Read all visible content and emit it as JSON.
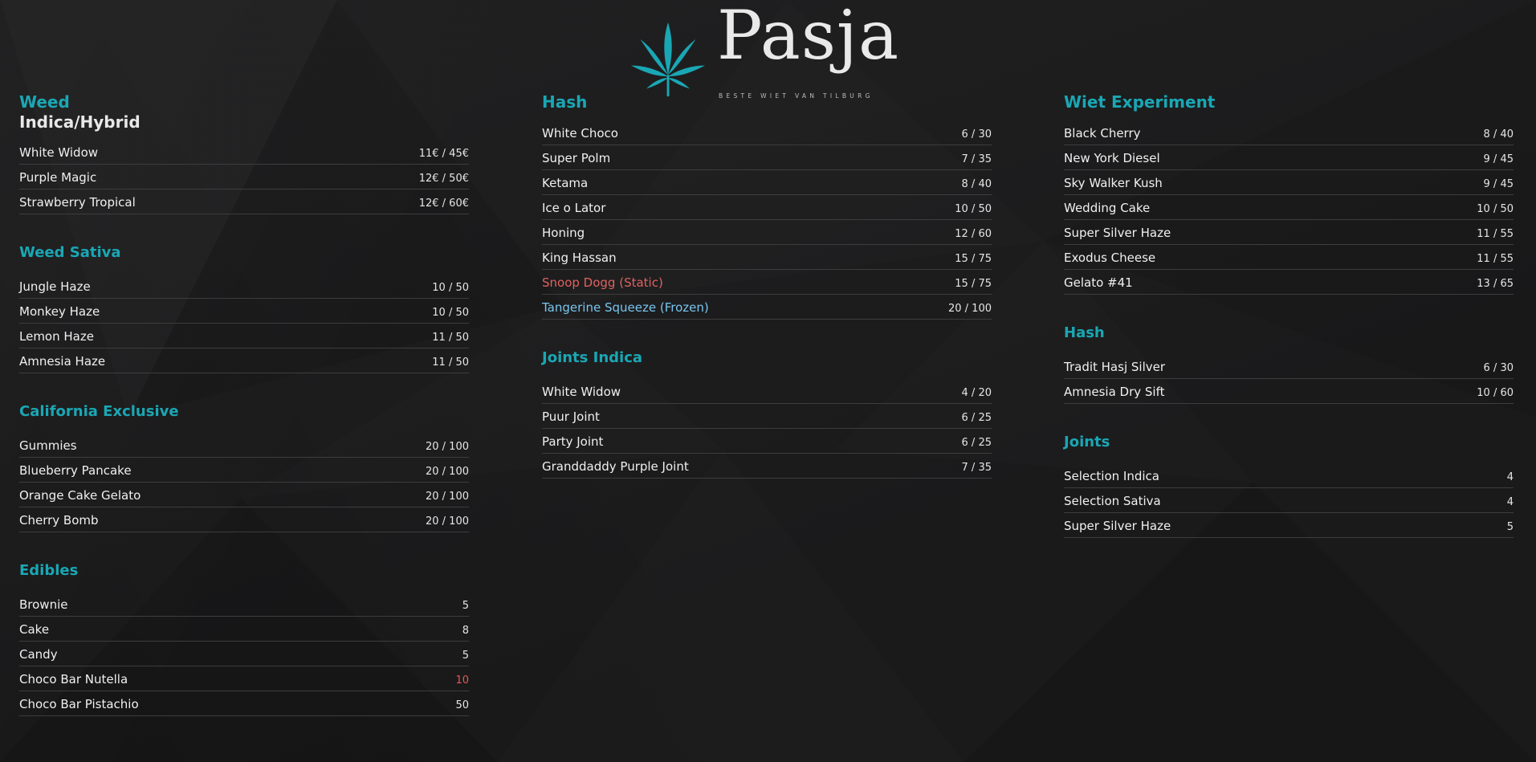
{
  "brand": {
    "name": "Pasja",
    "tagline": "BESTE WIET VAN TILBURG",
    "logo_icon": "cannabis-leaf-icon",
    "accent_color": "#1aa7b4"
  },
  "columns": [
    {
      "sections": [
        {
          "title": "Weed",
          "subtitle": "Indica/Hybrid",
          "items": [
            {
              "name": "White Widow",
              "price": "11€ / 45€"
            },
            {
              "name": "Purple Magic",
              "price": "12€ / 50€"
            },
            {
              "name": "Strawberry Tropical",
              "price": "12€ / 60€"
            }
          ]
        },
        {
          "title": "Weed Sativa",
          "items": [
            {
              "name": "Jungle Haze",
              "price": "10 / 50"
            },
            {
              "name": "Monkey Haze",
              "price": "10 / 50"
            },
            {
              "name": "Lemon Haze",
              "price": "11 / 50"
            },
            {
              "name": "Amnesia Haze",
              "price": "11 / 50"
            }
          ]
        },
        {
          "title": "California Exclusive",
          "items": [
            {
              "name": "Gummies",
              "price": "20 / 100"
            },
            {
              "name": "Blueberry Pancake",
              "price": "20 / 100"
            },
            {
              "name": "Orange Cake Gelato",
              "price": "20 / 100"
            },
            {
              "name": "Cherry Bomb",
              "price": "20 / 100"
            }
          ]
        },
        {
          "title": "Edibles",
          "items": [
            {
              "name": "Brownie",
              "price": "5"
            },
            {
              "name": "Cake",
              "price": "8"
            },
            {
              "name": "Candy",
              "price": "5"
            },
            {
              "name": "Choco Bar Nutella",
              "price": "10",
              "price_color": "red"
            },
            {
              "name": "Choco Bar Pistachio",
              "price": "50"
            }
          ]
        }
      ]
    },
    {
      "sections": [
        {
          "title": "Hash",
          "items": [
            {
              "name": "White Choco",
              "price": "6 / 30"
            },
            {
              "name": "Super Polm",
              "price": "7 / 35"
            },
            {
              "name": "Ketama",
              "price": "8 / 40"
            },
            {
              "name": "Ice o Lator",
              "price": "10 / 50"
            },
            {
              "name": "Honing",
              "price": "12 / 60"
            },
            {
              "name": "King Hassan",
              "price": "15 / 75"
            },
            {
              "name": "Snoop Dogg (Static)",
              "price": "15 / 75",
              "name_color": "red"
            },
            {
              "name": "Tangerine Squeeze (Frozen)",
              "price": "20 / 100",
              "name_color": "blue"
            }
          ]
        },
        {
          "title": "Joints Indica",
          "items": [
            {
              "name": "White Widow",
              "price": "4 / 20"
            },
            {
              "name": "Puur Joint",
              "price": "6 / 25"
            },
            {
              "name": "Party Joint",
              "price": "6 / 25"
            },
            {
              "name": "Granddaddy Purple Joint",
              "price": "7 / 35"
            }
          ]
        }
      ]
    },
    {
      "sections": [
        {
          "title": "Wiet Experiment",
          "items": [
            {
              "name": "Black Cherry",
              "price": "8 / 40"
            },
            {
              "name": "New York Diesel",
              "price": "9 / 45"
            },
            {
              "name": "Sky Walker Kush",
              "price": "9 / 45"
            },
            {
              "name": "Wedding Cake",
              "price": "10 / 50"
            },
            {
              "name": "Super Silver Haze",
              "price": "11 / 55"
            },
            {
              "name": "Exodus Cheese",
              "price": "11 / 55"
            },
            {
              "name": "Gelato #41",
              "price": "13 / 65"
            }
          ]
        },
        {
          "title": "Hash",
          "items": [
            {
              "name": "Tradit Hasj Silver",
              "price": "6 / 30"
            },
            {
              "name": "Amnesia Dry Sift",
              "price": "10 / 60"
            }
          ]
        },
        {
          "title": "Joints",
          "items": [
            {
              "name": "Selection Indica",
              "price": "4"
            },
            {
              "name": "Selection Sativa",
              "price": "4"
            },
            {
              "name": "Super Silver Haze",
              "price": "5"
            }
          ]
        }
      ]
    }
  ]
}
